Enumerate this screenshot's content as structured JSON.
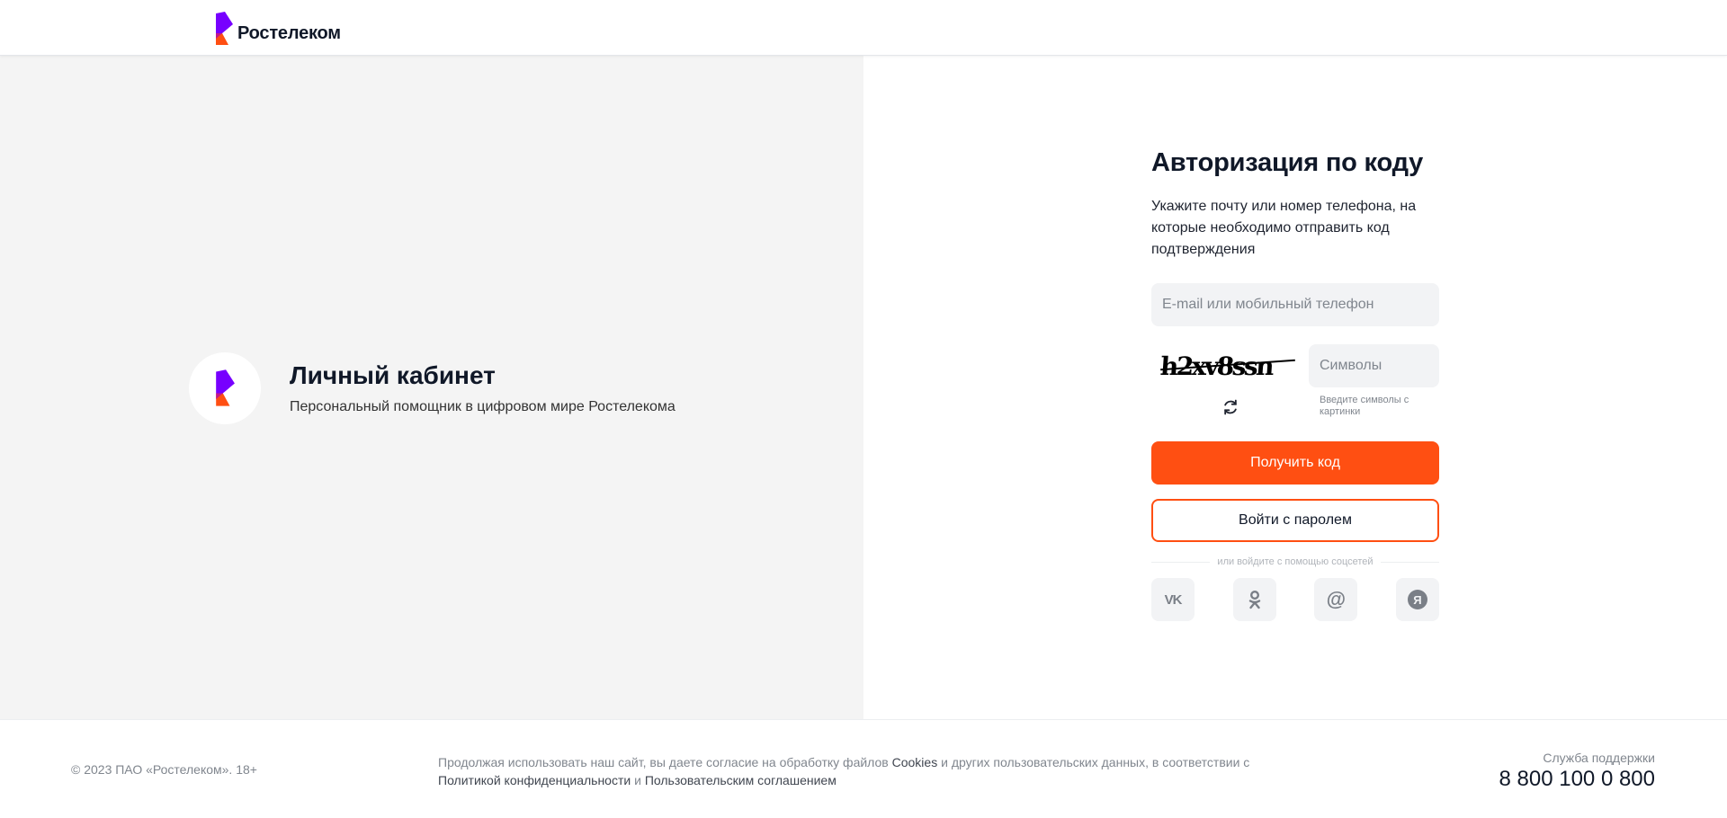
{
  "header": {
    "brand_name": "Ростелеком"
  },
  "promo": {
    "title": "Личный кабинет",
    "subtitle": "Персональный помощник в цифровом мире Ростелекома"
  },
  "form": {
    "title": "Авторизация по коду",
    "description": "Укажите почту или номер телефона, на которые необходимо отправить код подтверждения",
    "contact_input": {
      "placeholder": "E-mail или мобильный телефон",
      "value": ""
    },
    "captcha": {
      "image_text": "h2xv8ssn",
      "input_placeholder": "Символы",
      "input_value": "",
      "hint": "Введите символы с картинки"
    },
    "get_code_label": "Получить код",
    "password_login_label": "Войти с паролем",
    "social_divider": "или войдите с помощью соцсетей",
    "socials": [
      {
        "name": "vk",
        "glyph": "VK"
      },
      {
        "name": "odnoklassniki",
        "glyph": "ok"
      },
      {
        "name": "mail",
        "glyph": "@"
      },
      {
        "name": "yandex",
        "glyph": "Я"
      }
    ]
  },
  "footer": {
    "copyright": "© 2023 ПАО «Ростелеком». 18+",
    "consent": {
      "part1": "Продолжая использовать наш сайт, вы даете согласие на обработку файлов ",
      "cookies_link": "Cookies",
      "part2": " и других пользовательских данных, в соответствии с ",
      "privacy_link": "Политикой конфиденциальности",
      "part3": " и ",
      "agreement_link": "Пользовательским соглашением"
    },
    "support_label": "Служба поддержки",
    "support_phone": "8 800 100 0 800"
  },
  "colors": {
    "accent": "#ff4f12",
    "brand_purple": "#7700ff",
    "left_panel_bg": "#f4f4f4"
  }
}
